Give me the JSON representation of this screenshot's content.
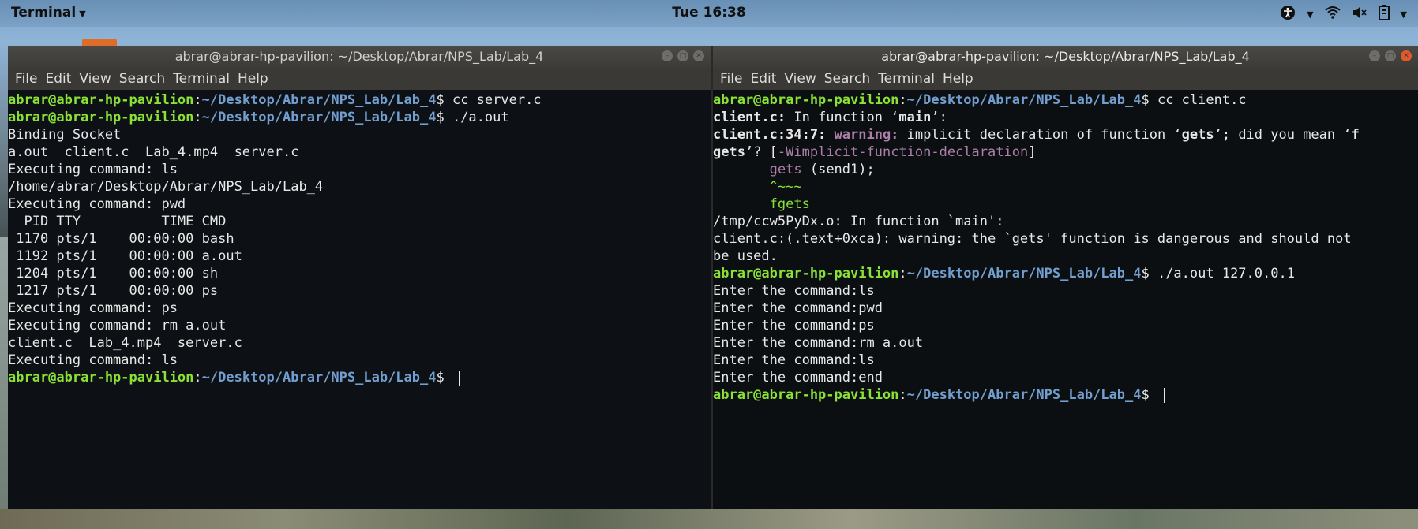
{
  "topbar": {
    "app_menu": "Terminal",
    "clock": "Tue 16:38",
    "tray_icons": [
      "accessibility-icon",
      "wifi-icon",
      "volume-muted-icon",
      "battery-icon",
      "power-caret-icon"
    ]
  },
  "left_window": {
    "title": "abrar@abrar-hp-pavilion: ~/Desktop/Abrar/NPS_Lab/Lab_4",
    "menu": [
      "File",
      "Edit",
      "View",
      "Search",
      "Terminal",
      "Help"
    ],
    "prompt_user": "abrar@abrar-hp-pavilion",
    "prompt_path": "~/Desktop/Abrar/NPS_Lab/Lab_4",
    "lines": [
      {
        "type": "prompt",
        "cmd": "cc server.c"
      },
      {
        "type": "prompt",
        "cmd": "./a.out"
      },
      {
        "type": "text",
        "text": "Binding Socket"
      },
      {
        "type": "text",
        "text": "a.out  client.c  Lab_4.mp4  server.c"
      },
      {
        "type": "text",
        "text": "Executing command: ls"
      },
      {
        "type": "text",
        "text": "/home/abrar/Desktop/Abrar/NPS_Lab/Lab_4"
      },
      {
        "type": "text",
        "text": "Executing command: pwd"
      },
      {
        "type": "text",
        "text": "  PID TTY          TIME CMD"
      },
      {
        "type": "text",
        "text": " 1170 pts/1    00:00:00 bash"
      },
      {
        "type": "text",
        "text": " 1192 pts/1    00:00:00 a.out"
      },
      {
        "type": "text",
        "text": " 1204 pts/1    00:00:00 sh"
      },
      {
        "type": "text",
        "text": " 1217 pts/1    00:00:00 ps"
      },
      {
        "type": "text",
        "text": "Executing command: ps"
      },
      {
        "type": "text",
        "text": "Executing command: rm a.out"
      },
      {
        "type": "text",
        "text": "client.c  Lab_4.mp4  server.c"
      },
      {
        "type": "text",
        "text": "Executing command: ls"
      },
      {
        "type": "prompt",
        "cmd": ""
      }
    ]
  },
  "right_window": {
    "title": "abrar@abrar-hp-pavilion: ~/Desktop/Abrar/NPS_Lab/Lab_4",
    "menu": [
      "File",
      "Edit",
      "View",
      "Search",
      "Terminal",
      "Help"
    ],
    "prompt_user": "abrar@abrar-hp-pavilion",
    "prompt_path": "~/Desktop/Abrar/NPS_Lab/Lab_4",
    "lines": {
      "l1_cmd": "cc client.c",
      "l2_file": "client.c:",
      "l2_rest": " In function ‘",
      "l2_fn": "main",
      "l2_end": "’:",
      "l3_loc": "client.c:34:7:",
      "l3_warn": " warning:",
      "l3_msg": " implicit declaration of function ‘",
      "l3_fn": "gets",
      "l3_msg2": "’; did you mean ‘",
      "l3_sugg": "f",
      "l4_sugg": "gets",
      "l4_rest": "’? [",
      "l4_flag": "-Wimplicit-function-declaration",
      "l4_end": "]",
      "l5_gets": "gets",
      "l5_rest": " (send1);",
      "l6_caret": "^~~~",
      "l7_fix": "fgets",
      "l8": "/tmp/ccw5PyDx.o: In function `main':",
      "l9": "client.c:(.text+0xca): warning: the `gets' function is dangerous and should not",
      "l10": "be used.",
      "l11_cmd": "./a.out 127.0.0.1",
      "enter": [
        "Enter the command:ls",
        "Enter the command:pwd",
        "Enter the command:ps",
        "Enter the command:rm a.out",
        "Enter the command:ls",
        "Enter the command:end"
      ]
    }
  }
}
